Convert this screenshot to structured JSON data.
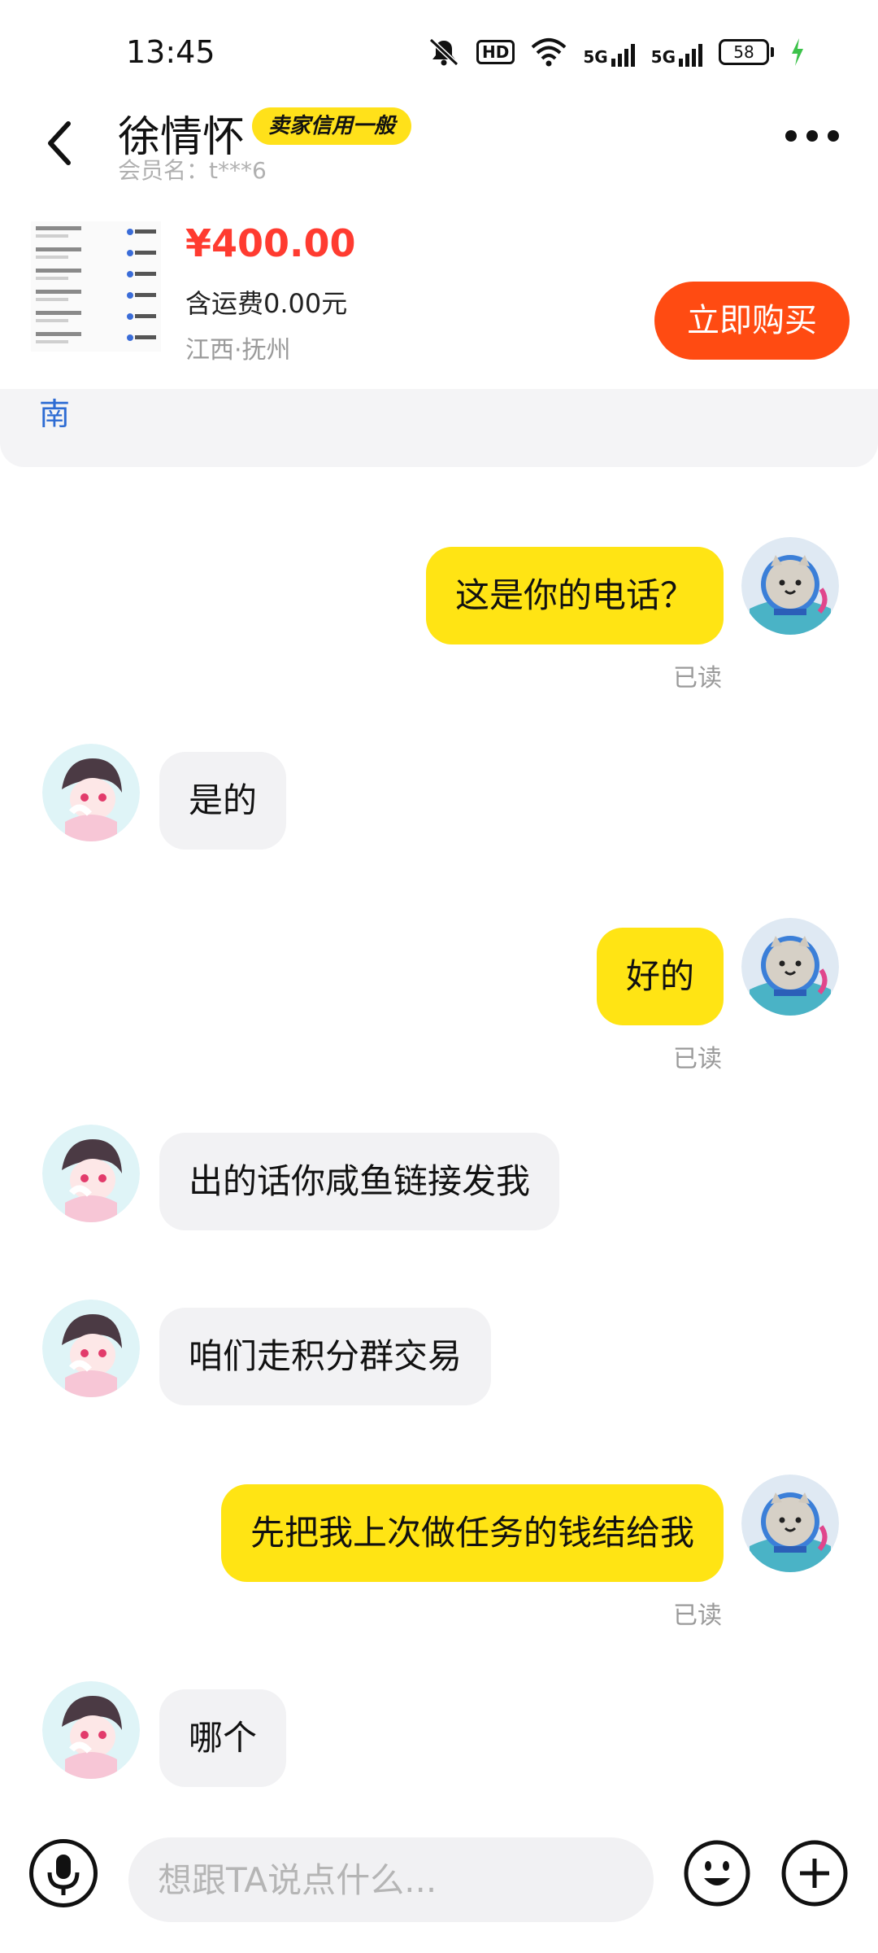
{
  "status_bar": {
    "time": "13:45",
    "hd_label": "HD",
    "network_1": "5G",
    "network_2": "5G",
    "battery": "58",
    "icons": [
      "mute-icon",
      "wifi-icon",
      "signal-icon",
      "charging-icon"
    ]
  },
  "header": {
    "seller_name": "徐情怀",
    "credit_badge": "卖家信用一般",
    "member_label": "会员名：t***6",
    "back_icon": "chevron-left-icon",
    "more_icon": "more-dots-icon"
  },
  "product": {
    "price": "¥400.00",
    "shipping": "含运费0.00元",
    "location": "江西·抚州",
    "buy_button": "立即购买"
  },
  "notice": {
    "text": "南"
  },
  "messages": [
    {
      "from": "me",
      "text": "这是你的电话？",
      "status": "已读"
    },
    {
      "from": "them",
      "text": "是的"
    },
    {
      "from": "me",
      "text": "好的",
      "status": "已读"
    },
    {
      "from": "them",
      "text": "出的话你咸鱼链接发我"
    },
    {
      "from": "them",
      "text": "咱们走积分群交易"
    },
    {
      "from": "me",
      "text": "先把我上次做任务的钱结给我",
      "status": "已读"
    },
    {
      "from": "them",
      "text": "哪个"
    }
  ],
  "input_bar": {
    "placeholder": "想跟TA说点什么...",
    "mic_icon": "microphone-icon",
    "emoji_icon": "emoji-icon",
    "plus_icon": "plus-icon"
  },
  "colors": {
    "my_bubble": "#ffe414",
    "their_bubble": "#f2f2f4",
    "price": "#ff3b30",
    "buy_button": "#ff4b12",
    "badge": "#ffe11a"
  }
}
